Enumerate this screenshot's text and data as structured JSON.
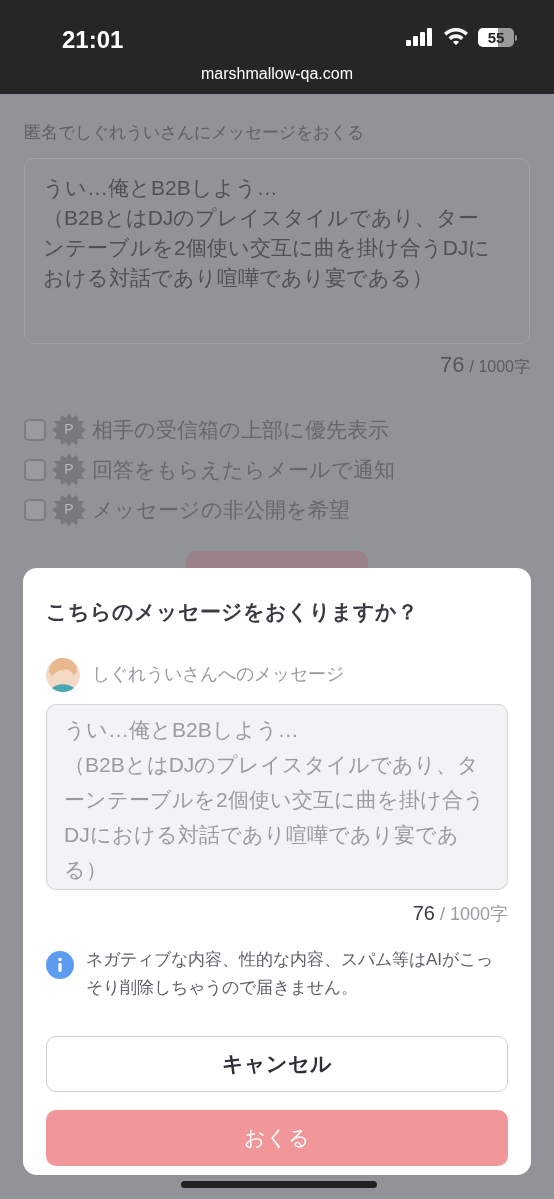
{
  "status_bar": {
    "time": "21:01",
    "battery": "55",
    "url": "marshmallow-qa.com"
  },
  "form": {
    "label": "匿名でしぐれういさんにメッセージをおくる",
    "message": "うい…俺とB2Bしよう…\n（B2BとはDJのプレイスタイルであり、ターンテーブルを2個使い交互に曲を掛け合うDJにおける対話であり喧嘩であり宴である）",
    "count": "76",
    "limit": "/ 1000字",
    "options": [
      {
        "badge": "P",
        "label": "相手の受信箱の上部に優先表示",
        "checked": false
      },
      {
        "badge": "P",
        "label": "回答をもらえたらメールで通知",
        "checked": false
      },
      {
        "badge": "P",
        "label": "メッセージの非公開を希望",
        "checked": false
      }
    ]
  },
  "dialog": {
    "title": "こちらのメッセージをおくりますか？",
    "recipient": "しぐれういさんへのメッセージ",
    "message": "うい…俺とB2Bしよう…\n（B2BとはDJのプレイスタイルであり、ターンテーブルを2個使い交互に曲を掛け合うDJにおける対話であり喧嘩であり宴である）",
    "count": "76",
    "limit": "/ 1000字",
    "notice": "ネガティブな内容、性的な内容、スパム等はAIがこっそり削除しちゃうので届きません。",
    "cancel": "キャンセル",
    "send": "おくる"
  }
}
